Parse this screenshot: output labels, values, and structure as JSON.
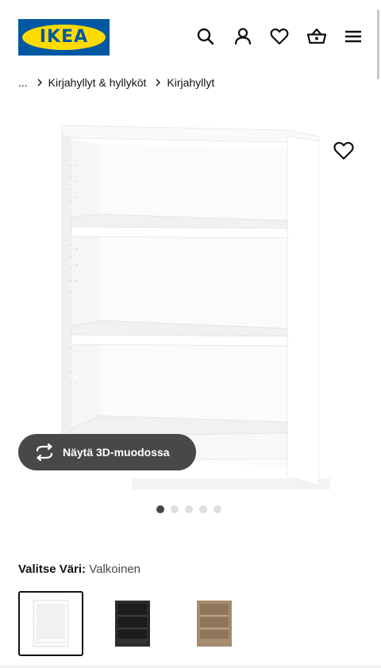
{
  "header": {
    "logo_text": "IKEA",
    "brand_colors": {
      "blue": "#0058a3",
      "yellow": "#ffdb00"
    },
    "icons": [
      "search-icon",
      "account-icon",
      "wishlist-heart-icon",
      "shopping-bag-icon",
      "menu-icon"
    ]
  },
  "breadcrumb": {
    "ellipsis": "...",
    "items": [
      "Kirjahyllyt & hyllyköt",
      "Kirjahyllyt"
    ]
  },
  "gallery": {
    "view_3d_label": "Näytä 3D-muodossa",
    "slide_count": 5,
    "active_slide": 1
  },
  "color_picker": {
    "label": "Valitse Väri:",
    "selected_value": "Valkoinen",
    "options": [
      {
        "name": "white",
        "color": "#f7f7f7",
        "selected": true
      },
      {
        "name": "black",
        "color": "#2b2b2b",
        "selected": false
      },
      {
        "name": "oak",
        "color": "#a58b6d",
        "selected": false
      }
    ]
  }
}
